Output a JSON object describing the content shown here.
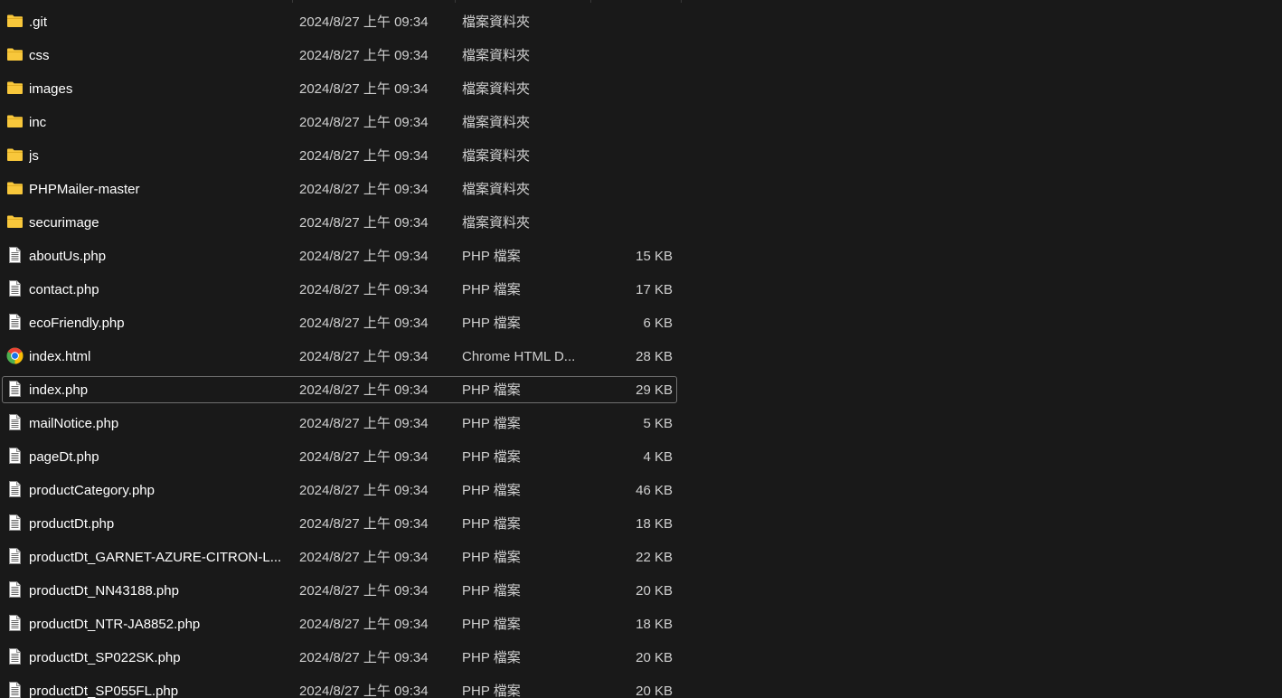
{
  "files": [
    {
      "name": ".git",
      "date": "2024/8/27 上午 09:34",
      "type": "檔案資料夾",
      "size": "",
      "icon": "folder-icon"
    },
    {
      "name": "css",
      "date": "2024/8/27 上午 09:34",
      "type": "檔案資料夾",
      "size": "",
      "icon": "folder-icon"
    },
    {
      "name": "images",
      "date": "2024/8/27 上午 09:34",
      "type": "檔案資料夾",
      "size": "",
      "icon": "folder-icon"
    },
    {
      "name": "inc",
      "date": "2024/8/27 上午 09:34",
      "type": "檔案資料夾",
      "size": "",
      "icon": "folder-icon"
    },
    {
      "name": "js",
      "date": "2024/8/27 上午 09:34",
      "type": "檔案資料夾",
      "size": "",
      "icon": "folder-icon"
    },
    {
      "name": "PHPMailer-master",
      "date": "2024/8/27 上午 09:34",
      "type": "檔案資料夾",
      "size": "",
      "icon": "folder-icon"
    },
    {
      "name": "securimage",
      "date": "2024/8/27 上午 09:34",
      "type": "檔案資料夾",
      "size": "",
      "icon": "folder-icon"
    },
    {
      "name": "aboutUs.php",
      "date": "2024/8/27 上午 09:34",
      "type": "PHP 檔案",
      "size": "15 KB",
      "icon": "document-icon"
    },
    {
      "name": "contact.php",
      "date": "2024/8/27 上午 09:34",
      "type": "PHP 檔案",
      "size": "17 KB",
      "icon": "document-icon"
    },
    {
      "name": "ecoFriendly.php",
      "date": "2024/8/27 上午 09:34",
      "type": "PHP 檔案",
      "size": "6 KB",
      "icon": "document-icon"
    },
    {
      "name": "index.html",
      "date": "2024/8/27 上午 09:34",
      "type": "Chrome HTML D...",
      "size": "28 KB",
      "icon": "chrome-icon"
    },
    {
      "name": "index.php",
      "date": "2024/8/27 上午 09:34",
      "type": "PHP 檔案",
      "size": "29 KB",
      "icon": "document-icon",
      "selected": true
    },
    {
      "name": "mailNotice.php",
      "date": "2024/8/27 上午 09:34",
      "type": "PHP 檔案",
      "size": "5 KB",
      "icon": "document-icon"
    },
    {
      "name": "pageDt.php",
      "date": "2024/8/27 上午 09:34",
      "type": "PHP 檔案",
      "size": "4 KB",
      "icon": "document-icon"
    },
    {
      "name": "productCategory.php",
      "date": "2024/8/27 上午 09:34",
      "type": "PHP 檔案",
      "size": "46 KB",
      "icon": "document-icon"
    },
    {
      "name": "productDt.php",
      "date": "2024/8/27 上午 09:34",
      "type": "PHP 檔案",
      "size": "18 KB",
      "icon": "document-icon"
    },
    {
      "name": "productDt_GARNET-AZURE-CITRON-L...",
      "date": "2024/8/27 上午 09:34",
      "type": "PHP 檔案",
      "size": "22 KB",
      "icon": "document-icon"
    },
    {
      "name": "productDt_NN43188.php",
      "date": "2024/8/27 上午 09:34",
      "type": "PHP 檔案",
      "size": "20 KB",
      "icon": "document-icon"
    },
    {
      "name": "productDt_NTR-JA8852.php",
      "date": "2024/8/27 上午 09:34",
      "type": "PHP 檔案",
      "size": "18 KB",
      "icon": "document-icon"
    },
    {
      "name": "productDt_SP022SK.php",
      "date": "2024/8/27 上午 09:34",
      "type": "PHP 檔案",
      "size": "20 KB",
      "icon": "document-icon"
    },
    {
      "name": "productDt_SP055FL.php",
      "date": "2024/8/27 上午 09:34",
      "type": "PHP 檔案",
      "size": "20 KB",
      "icon": "document-icon"
    }
  ],
  "colors": {
    "background": "#191919",
    "folder": "#f8c73b",
    "selection_border": "#707070"
  }
}
